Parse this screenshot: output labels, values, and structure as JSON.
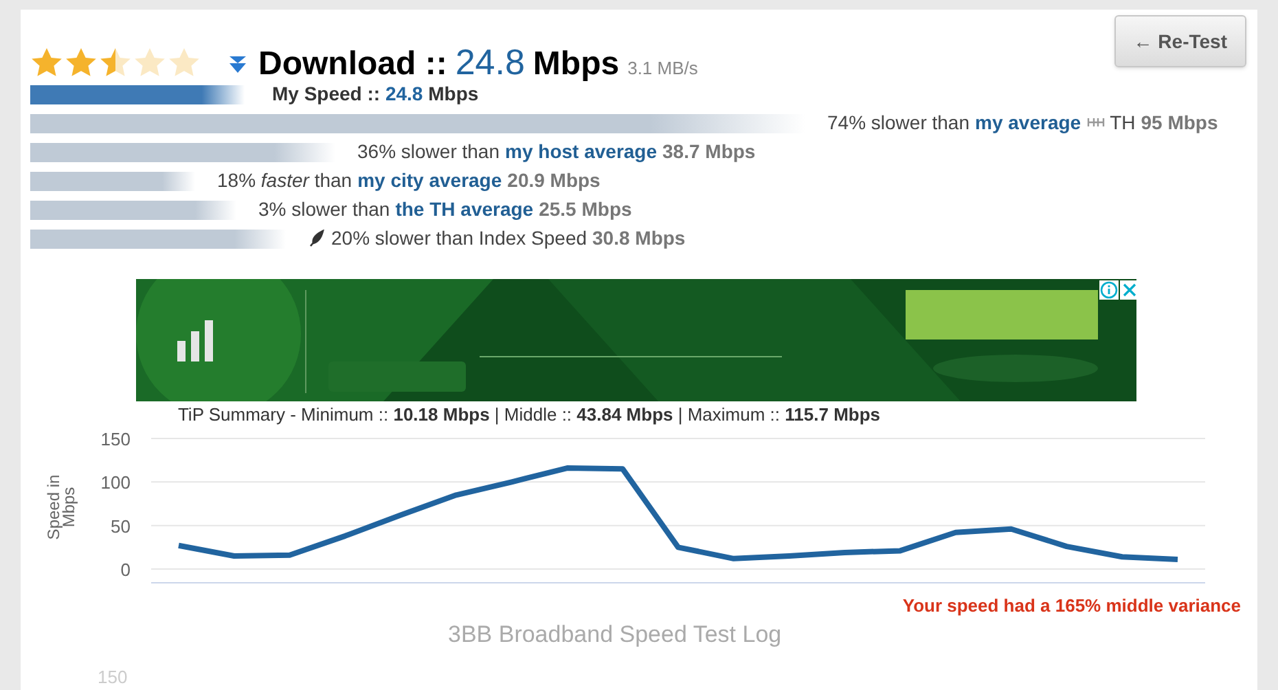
{
  "header": {
    "stars": 2.5,
    "direction": "Download",
    "separator": "::",
    "speed": "24.8",
    "unit": "Mbps",
    "rate": "3.1 MB/s"
  },
  "retest_button": "← Re-Test",
  "my_speed": {
    "label": "My Speed ::",
    "speed": "24.8",
    "unit": "Mbps"
  },
  "comparisons": [
    {
      "parts": [
        {
          "kind": "text",
          "text": "74% slower than"
        },
        {
          "kind": "link",
          "text": "my average"
        },
        {
          "kind": "icon"
        },
        {
          "kind": "text",
          "text": "TH"
        },
        {
          "kind": "value",
          "text": "95 Mbps"
        }
      ]
    },
    {
      "parts": [
        {
          "kind": "text",
          "text": "36% slower than"
        },
        {
          "kind": "link",
          "text": "my host average"
        },
        {
          "kind": "value",
          "text": "38.7 Mbps"
        }
      ]
    },
    {
      "parts": [
        {
          "kind": "text",
          "text": "18% *faster* than"
        },
        {
          "kind": "link",
          "text": "my city average"
        },
        {
          "kind": "value",
          "text": "20.9 Mbps"
        }
      ]
    },
    {
      "parts": [
        {
          "kind": "text",
          "text": "3% slower than"
        },
        {
          "kind": "link",
          "text": "the TH average"
        },
        {
          "kind": "value",
          "text": "25.5 Mbps"
        }
      ]
    },
    {
      "parts": [
        {
          "kind": "icon"
        },
        {
          "kind": "text",
          "text": "20% slower than Index Speed"
        },
        {
          "kind": "value",
          "text": "30.8 Mbps"
        }
      ]
    }
  ],
  "summary_chart": {
    "title": "TiP Summary - Minimum :: **10.18 Mbps** | Middle :: **43.84 Mbps** | Maximum :: **115.7 Mbps**",
    "chart_data": {
      "type": "line",
      "ylabel": "Speed in Mbps",
      "ylim": [
        0,
        150
      ],
      "yticks": [
        0,
        50,
        100,
        150
      ],
      "series": [
        {
          "color": "#21649f",
          "values": [
            27,
            15,
            16,
            38,
            62,
            85,
            100,
            116,
            115,
            25,
            12,
            15,
            19,
            21,
            42,
            46,
            26,
            14,
            11
          ]
        }
      ]
    }
  },
  "variance_note": "Your speed had a 165% middle variance",
  "log_chart": {
    "title": "3BB Broadband Speed Test Log",
    "tick": "150"
  }
}
